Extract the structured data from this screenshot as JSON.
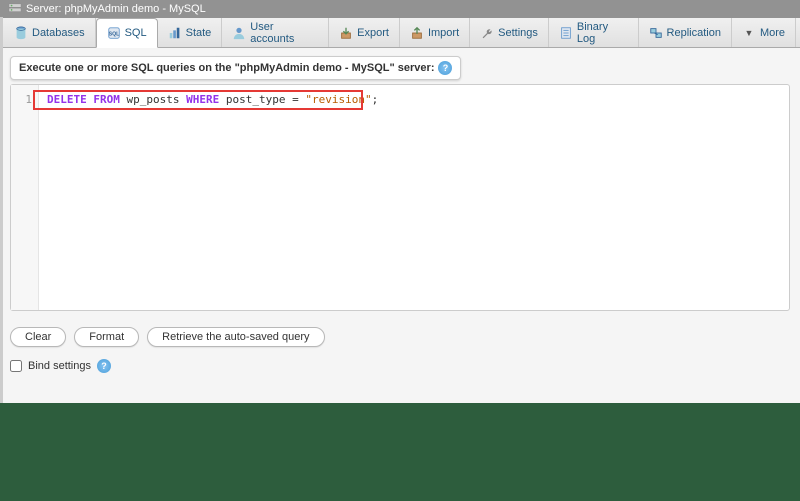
{
  "breadcrumb": {
    "server_label": "Server: phpMyAdmin demo - MySQL"
  },
  "nav_tabs": [
    {
      "id": "databases",
      "label": "Databases",
      "icon": "database-icon"
    },
    {
      "id": "sql",
      "label": "SQL",
      "icon": "sql-icon",
      "active": true
    },
    {
      "id": "status",
      "label": "State",
      "icon": "status-icon"
    },
    {
      "id": "users",
      "label": "User accounts",
      "icon": "users-icon"
    },
    {
      "id": "export",
      "label": "Export",
      "icon": "export-icon"
    },
    {
      "id": "import",
      "label": "Import",
      "icon": "import-icon"
    },
    {
      "id": "settings",
      "label": "Settings",
      "icon": "wrench-icon"
    },
    {
      "id": "binlog",
      "label": "Binary Log",
      "icon": "binlog-icon"
    },
    {
      "id": "replication",
      "label": "Replication",
      "icon": "replication-icon"
    },
    {
      "id": "more",
      "label": "More",
      "icon": "dropdown-icon"
    }
  ],
  "legend": {
    "text": "Execute one or more SQL queries on the \"phpMyAdmin demo - MySQL\" server:",
    "help": "?"
  },
  "editor": {
    "line_number": "1",
    "keyword_delete": "DELETE",
    "keyword_from": "FROM",
    "identifier_table": "wp_posts",
    "keyword_where": "WHERE",
    "identifier_column": "post_type",
    "operator_equals": "=",
    "string_value": "\"revision\"",
    "terminator": ";",
    "full_query": "DELETE FROM wp_posts WHERE post_type = \"revision\";"
  },
  "buttons": {
    "clear": "Clear",
    "format": "Format",
    "retrieve": "Retrieve the auto-saved query"
  },
  "bind_settings": {
    "label": "Bind settings",
    "help": "?"
  }
}
